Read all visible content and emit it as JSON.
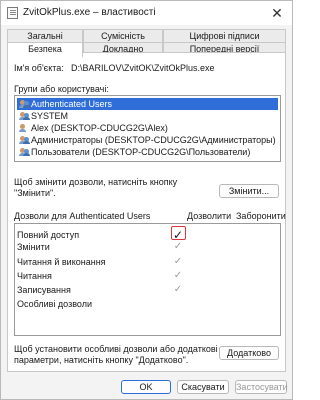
{
  "window": {
    "title": "ZvitOkPlus.exe – властивості",
    "close_glyph": "✕"
  },
  "tabs_row1": [
    "Загальні",
    "Сумісність",
    "Цифрові підписи"
  ],
  "tabs_row2": [
    "Безпека",
    "Докладно",
    "Попередні версії"
  ],
  "object": {
    "label": "Ім'я об'єкта:",
    "value": "D:\\BARILOV\\ZvitOK\\ZvitOkPlus.exe"
  },
  "groups": {
    "label": "Групи або користувачі:",
    "items": [
      {
        "name": "Authenticated Users",
        "icon": "users-icon"
      },
      {
        "name": "SYSTEM",
        "icon": "users-icon"
      },
      {
        "name": "Alex (DESKTOP-CDUCG2G\\Alex)",
        "icon": "user-icon"
      },
      {
        "name": "Администраторы (DESKTOP-CDUCG2G\\Администраторы)",
        "icon": "users-icon"
      },
      {
        "name": "Пользователи (DESKTOP-CDUCG2G\\Пользователи)",
        "icon": "users-icon"
      }
    ],
    "selected_index": 0
  },
  "change_hint": {
    "line1": "Щоб змінити дозволи, натисніть кнопку",
    "line2": "\"Змінити\"."
  },
  "change_button": "Змінити...",
  "permissions": {
    "header": "Дозволи для Authenticated Users",
    "allow_header": "Дозволити",
    "deny_header": "Заборонити",
    "rows": [
      {
        "name": "Повний доступ",
        "allow": true,
        "allow_style": "active"
      },
      {
        "name": "Змінити",
        "allow": true,
        "allow_style": "grey"
      },
      {
        "name": "Читання й виконання",
        "allow": true,
        "allow_style": "grey"
      },
      {
        "name": "Читання",
        "allow": true,
        "allow_style": "grey"
      },
      {
        "name": "Записування",
        "allow": true,
        "allow_style": "grey"
      },
      {
        "name": "Особливі дозволи",
        "allow": false,
        "allow_style": "none"
      }
    ],
    "check_glyph": "✓"
  },
  "advanced_hint": {
    "line1": "Щоб установити особливі дозволи або додаткові",
    "line2": "параметри, натисніть кнопку \"Додатково\"."
  },
  "advanced_button": "Додатково",
  "footer": {
    "ok": "OK",
    "cancel": "Скасувати",
    "apply": "Застосувати"
  },
  "colors": {
    "selection": "#2f6ed8",
    "highlight_box": "#d63a3a"
  }
}
